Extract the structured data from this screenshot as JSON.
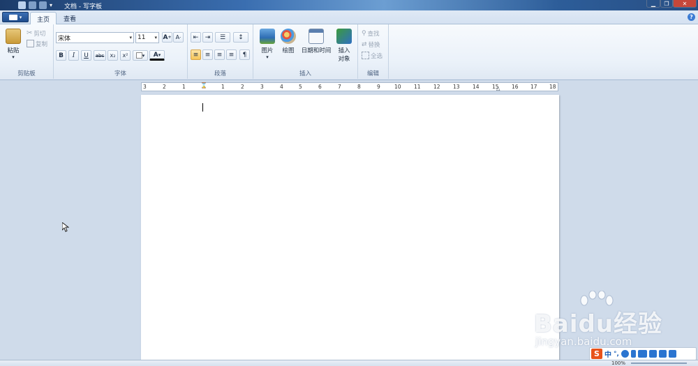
{
  "titlebar": {
    "title": "文档 - 写字板"
  },
  "tabs": [
    {
      "label": "主页"
    },
    {
      "label": "查看"
    }
  ],
  "ribbon": {
    "clipboard": {
      "label": "剪贴板",
      "paste": "粘贴",
      "cut": "剪切",
      "copy": "复制"
    },
    "font": {
      "label": "字体",
      "family": "宋体",
      "size": "11",
      "bold": "B",
      "italic": "I",
      "underline": "U",
      "strike": "abc",
      "subscript": "x₂",
      "superscript": "x²",
      "color": "A"
    },
    "paragraph": {
      "label": "段落"
    },
    "insert": {
      "label": "插入",
      "picture": "图片",
      "paint": "绘图",
      "datetime": "日期和时间",
      "object_line1": "插入",
      "object_line2": "对象"
    },
    "editing": {
      "label": "编辑",
      "find": "查找",
      "replace": "替换",
      "select_all": "全选"
    }
  },
  "ruler": {
    "labels": [
      "3",
      "2",
      "1",
      "1",
      "2",
      "3",
      "4",
      "5",
      "6",
      "7",
      "8",
      "9",
      "10",
      "11",
      "12",
      "13",
      "14",
      "15",
      "16",
      "17",
      "18"
    ]
  },
  "statusbar": {
    "zoom": "100%"
  },
  "ime": {
    "lang": "中"
  },
  "watermark": {
    "brand": "Baidu经验",
    "url": "jingyan.baidu.com"
  },
  "colors": {
    "accent": "#3b6fb4",
    "ribbon_bg": "#eaf1f9",
    "canvas_bg": "#cfdbea"
  }
}
